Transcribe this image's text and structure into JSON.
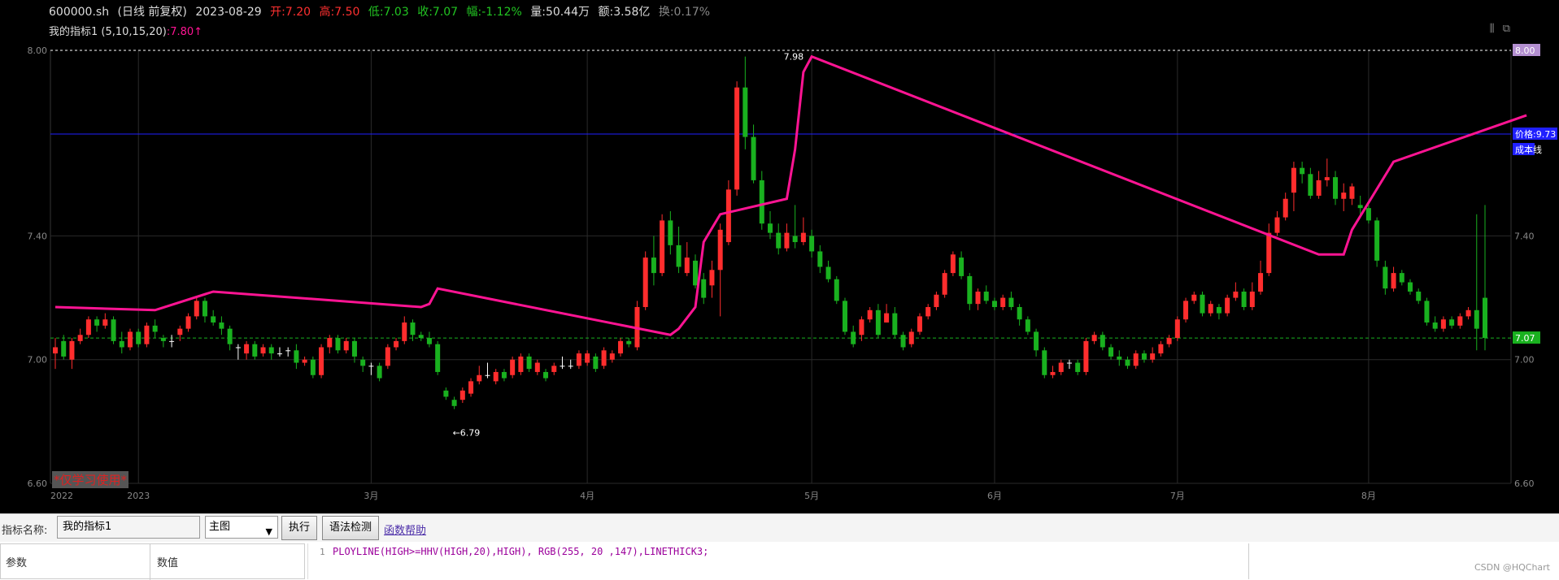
{
  "header": {
    "symbol": "600000.sh",
    "period": "(日线 前复权)",
    "date": "2023-08-29",
    "open": "开:7.20",
    "high": "高:7.50",
    "low": "低:7.03",
    "close": "收:7.07",
    "change": "幅:-1.12%",
    "volume": "量:50.44万",
    "amount": "额:3.58亿",
    "turnover": "换:0.17%"
  },
  "indicator": {
    "name": "我的指标1 (5,10,15,20)",
    "value": ":7.80",
    "arrow": "↑"
  },
  "toolbar_icons": [
    "chart-toggle-icon",
    "popout-icon"
  ],
  "watermark": "*仅学习使用*",
  "chart_data": {
    "type": "candlestick",
    "y_ticks": [
      "8.00",
      "7.40",
      "7.00",
      "6.60"
    ],
    "ylim": [
      6.6,
      8.0
    ],
    "x_ticks": [
      "2022",
      "2023",
      "3月",
      "4月",
      "5月",
      "6月",
      "7月",
      "8月"
    ],
    "high_label": "7.98",
    "low_label": "←6.79",
    "price_label": "价格:9.73",
    "cost_label": "成本线",
    "last_price": "7.07",
    "top_price": "8.00",
    "colors": {
      "up": "#ff2d2d",
      "down": "#19b11f",
      "line": "#ff1493",
      "cost_line": "#2020ff",
      "last_line": "#19b11f"
    },
    "candles": [
      [
        7.02,
        7.04,
        7.07,
        6.97
      ],
      [
        7.06,
        7.01,
        7.08,
        7.0
      ],
      [
        7.0,
        7.06,
        7.07,
        6.97
      ],
      [
        7.06,
        7.08,
        7.1,
        7.05
      ],
      [
        7.08,
        7.13,
        7.14,
        7.07
      ],
      [
        7.13,
        7.11,
        7.14,
        7.09
      ],
      [
        7.11,
        7.13,
        7.15,
        7.1
      ],
      [
        7.13,
        7.06,
        7.14,
        7.05
      ],
      [
        7.06,
        7.04,
        7.09,
        7.02
      ],
      [
        7.04,
        7.09,
        7.1,
        7.03
      ],
      [
        7.09,
        7.05,
        7.1,
        7.04
      ],
      [
        7.05,
        7.11,
        7.12,
        7.04
      ],
      [
        7.11,
        7.09,
        7.13,
        7.07
      ],
      [
        7.07,
        7.06,
        7.08,
        7.04
      ],
      [
        7.06,
        7.06,
        7.08,
        7.04
      ],
      [
        7.08,
        7.1,
        7.11,
        7.06
      ],
      [
        7.1,
        7.14,
        7.15,
        7.09
      ],
      [
        7.14,
        7.19,
        7.2,
        7.13
      ],
      [
        7.19,
        7.14,
        7.2,
        7.12
      ],
      [
        7.14,
        7.12,
        7.16,
        7.11
      ],
      [
        7.12,
        7.1,
        7.14,
        7.08
      ],
      [
        7.1,
        7.05,
        7.11,
        7.03
      ],
      [
        7.04,
        7.04,
        7.05,
        7.0
      ],
      [
        7.02,
        7.05,
        7.06,
        7.0
      ],
      [
        7.05,
        7.01,
        7.06,
        7.0
      ],
      [
        7.02,
        7.04,
        7.05,
        7.01
      ],
      [
        7.04,
        7.02,
        7.05,
        7.0
      ],
      [
        7.02,
        7.02,
        7.04,
        7.01
      ],
      [
        7.03,
        7.03,
        7.04,
        7.01
      ],
      [
        7.03,
        6.99,
        7.05,
        6.97
      ],
      [
        6.99,
        7.0,
        7.01,
        6.98
      ],
      [
        7.0,
        6.95,
        7.01,
        6.94
      ],
      [
        6.95,
        7.04,
        7.05,
        6.94
      ],
      [
        7.04,
        7.07,
        7.08,
        7.02
      ],
      [
        7.07,
        7.03,
        7.08,
        7.02
      ],
      [
        7.03,
        7.06,
        7.07,
        7.02
      ],
      [
        7.06,
        7.01,
        7.07,
        6.99
      ],
      [
        7.0,
        6.98,
        7.01,
        6.96
      ],
      [
        6.98,
        6.98,
        6.99,
        6.95
      ],
      [
        6.98,
        6.94,
        6.99,
        6.93
      ],
      [
        6.98,
        7.04,
        7.05,
        6.97
      ],
      [
        7.04,
        7.06,
        7.07,
        7.03
      ],
      [
        7.06,
        7.12,
        7.14,
        7.05
      ],
      [
        7.12,
        7.08,
        7.13,
        7.06
      ],
      [
        7.08,
        7.07,
        7.09,
        7.06
      ],
      [
        7.07,
        7.05,
        7.09,
        7.04
      ],
      [
        7.05,
        6.96,
        7.06,
        6.95
      ],
      [
        6.9,
        6.88,
        6.91,
        6.87
      ],
      [
        6.87,
        6.85,
        6.88,
        6.84
      ],
      [
        6.87,
        6.9,
        6.91,
        6.86
      ],
      [
        6.89,
        6.93,
        6.94,
        6.88
      ],
      [
        6.93,
        6.95,
        6.98,
        6.92
      ],
      [
        6.95,
        6.95,
        6.99,
        6.94
      ],
      [
        6.93,
        6.96,
        6.97,
        6.92
      ],
      [
        6.96,
        6.94,
        6.97,
        6.93
      ],
      [
        6.95,
        7.0,
        7.01,
        6.94
      ],
      [
        6.96,
        7.01,
        7.02,
        6.95
      ],
      [
        7.01,
        6.97,
        7.02,
        6.96
      ],
      [
        6.96,
        6.99,
        7.0,
        6.95
      ],
      [
        6.96,
        6.94,
        6.97,
        6.93
      ],
      [
        6.96,
        6.98,
        6.99,
        6.95
      ],
      [
        6.98,
        6.98,
        7.01,
        6.97
      ],
      [
        6.98,
        6.98,
        7.0,
        6.97
      ],
      [
        6.98,
        7.02,
        7.03,
        6.97
      ],
      [
        6.99,
        7.02,
        7.03,
        6.98
      ],
      [
        7.01,
        6.97,
        7.02,
        6.96
      ],
      [
        6.98,
        7.03,
        7.04,
        6.97
      ],
      [
        7.0,
        7.02,
        7.03,
        6.99
      ],
      [
        7.02,
        7.06,
        7.07,
        7.01
      ],
      [
        7.06,
        7.05,
        7.07,
        7.04
      ],
      [
        7.04,
        7.17,
        7.19,
        7.03
      ],
      [
        7.17,
        7.33,
        7.35,
        7.16
      ],
      [
        7.33,
        7.28,
        7.4,
        7.24
      ],
      [
        7.28,
        7.45,
        7.47,
        7.27
      ],
      [
        7.45,
        7.37,
        7.48,
        7.34
      ],
      [
        7.37,
        7.3,
        7.43,
        7.28
      ],
      [
        7.28,
        7.33,
        7.38,
        7.27
      ],
      [
        7.32,
        7.24,
        7.34,
        7.23
      ],
      [
        7.26,
        7.2,
        7.28,
        7.18
      ],
      [
        7.24,
        7.29,
        7.32,
        7.2
      ],
      [
        7.29,
        7.42,
        7.44,
        7.14
      ],
      [
        7.38,
        7.55,
        7.58,
        7.37
      ],
      [
        7.55,
        7.88,
        7.9,
        7.53
      ],
      [
        7.88,
        7.72,
        7.98,
        7.68
      ],
      [
        7.72,
        7.58,
        7.76,
        7.57
      ],
      [
        7.58,
        7.44,
        7.61,
        7.42
      ],
      [
        7.44,
        7.41,
        7.48,
        7.39
      ],
      [
        7.41,
        7.36,
        7.44,
        7.34
      ],
      [
        7.36,
        7.41,
        7.44,
        7.35
      ],
      [
        7.4,
        7.38,
        7.5,
        7.36
      ],
      [
        7.38,
        7.41,
        7.46,
        7.37
      ],
      [
        7.4,
        7.35,
        7.42,
        7.33
      ],
      [
        7.35,
        7.3,
        7.37,
        7.28
      ],
      [
        7.3,
        7.26,
        7.32,
        7.25
      ],
      [
        7.26,
        7.19,
        7.27,
        7.18
      ],
      [
        7.19,
        7.09,
        7.2,
        7.08
      ],
      [
        7.09,
        7.05,
        7.11,
        7.04
      ],
      [
        7.08,
        7.13,
        7.14,
        7.06
      ],
      [
        7.13,
        7.16,
        7.17,
        7.12
      ],
      [
        7.16,
        7.08,
        7.18,
        7.07
      ],
      [
        7.12,
        7.15,
        7.18,
        7.12
      ],
      [
        7.15,
        7.08,
        7.17,
        7.07
      ],
      [
        7.08,
        7.04,
        7.09,
        7.03
      ],
      [
        7.05,
        7.09,
        7.1,
        7.04
      ],
      [
        7.09,
        7.14,
        7.15,
        7.08
      ],
      [
        7.14,
        7.17,
        7.18,
        7.13
      ],
      [
        7.17,
        7.21,
        7.22,
        7.16
      ],
      [
        7.21,
        7.28,
        7.29,
        7.2
      ],
      [
        7.28,
        7.34,
        7.35,
        7.27
      ],
      [
        7.33,
        7.27,
        7.35,
        7.26
      ],
      [
        7.27,
        7.18,
        7.28,
        7.16
      ],
      [
        7.18,
        7.22,
        7.23,
        7.16
      ],
      [
        7.22,
        7.19,
        7.24,
        7.18
      ],
      [
        7.19,
        7.17,
        7.2,
        7.16
      ],
      [
        7.17,
        7.2,
        7.21,
        7.16
      ],
      [
        7.2,
        7.17,
        7.22,
        7.16
      ],
      [
        7.17,
        7.13,
        7.18,
        7.11
      ],
      [
        7.13,
        7.09,
        7.14,
        7.08
      ],
      [
        7.09,
        7.03,
        7.1,
        7.01
      ],
      [
        7.03,
        6.95,
        7.04,
        6.94
      ],
      [
        6.95,
        6.96,
        6.98,
        6.94
      ],
      [
        6.96,
        6.99,
        7.0,
        6.95
      ],
      [
        6.99,
        6.99,
        7.0,
        6.97
      ],
      [
        6.99,
        6.96,
        7.0,
        6.95
      ],
      [
        6.96,
        7.06,
        7.07,
        6.95
      ],
      [
        7.06,
        7.08,
        7.09,
        7.05
      ],
      [
        7.08,
        7.04,
        7.09,
        7.03
      ],
      [
        7.04,
        7.01,
        7.05,
        7.0
      ],
      [
        7.01,
        7.0,
        7.03,
        6.98
      ],
      [
        7.0,
        6.98,
        7.01,
        6.97
      ],
      [
        6.98,
        7.02,
        7.03,
        6.97
      ],
      [
        7.02,
        7.0,
        7.03,
        6.99
      ],
      [
        7.0,
        7.02,
        7.04,
        6.99
      ],
      [
        7.02,
        7.05,
        7.06,
        7.01
      ],
      [
        7.05,
        7.07,
        7.08,
        7.04
      ],
      [
        7.07,
        7.13,
        7.14,
        7.06
      ],
      [
        7.13,
        7.19,
        7.2,
        7.12
      ],
      [
        7.19,
        7.21,
        7.22,
        7.18
      ],
      [
        7.21,
        7.15,
        7.22,
        7.14
      ],
      [
        7.15,
        7.18,
        7.19,
        7.14
      ],
      [
        7.17,
        7.15,
        7.18,
        7.13
      ],
      [
        7.15,
        7.2,
        7.21,
        7.14
      ],
      [
        7.2,
        7.22,
        7.25,
        7.19
      ],
      [
        7.22,
        7.17,
        7.23,
        7.16
      ],
      [
        7.17,
        7.22,
        7.25,
        7.16
      ],
      [
        7.22,
        7.28,
        7.32,
        7.21
      ],
      [
        7.28,
        7.41,
        7.44,
        7.27
      ],
      [
        7.41,
        7.46,
        7.48,
        7.4
      ],
      [
        7.46,
        7.52,
        7.54,
        7.45
      ],
      [
        7.54,
        7.62,
        7.64,
        7.48
      ],
      [
        7.62,
        7.6,
        7.64,
        7.57
      ],
      [
        7.6,
        7.53,
        7.62,
        7.52
      ],
      [
        7.53,
        7.58,
        7.61,
        7.52
      ],
      [
        7.58,
        7.59,
        7.65,
        7.56
      ],
      [
        7.59,
        7.52,
        7.61,
        7.5
      ],
      [
        7.52,
        7.54,
        7.57,
        7.48
      ],
      [
        7.52,
        7.56,
        7.57,
        7.5
      ],
      [
        7.5,
        7.49,
        7.53,
        7.47
      ],
      [
        7.49,
        7.45,
        7.5,
        7.44
      ],
      [
        7.45,
        7.32,
        7.46,
        7.3
      ],
      [
        7.3,
        7.23,
        7.32,
        7.21
      ],
      [
        7.23,
        7.28,
        7.3,
        7.22
      ],
      [
        7.28,
        7.25,
        7.29,
        7.24
      ],
      [
        7.25,
        7.22,
        7.26,
        7.21
      ],
      [
        7.22,
        7.19,
        7.23,
        7.18
      ],
      [
        7.19,
        7.12,
        7.2,
        7.11
      ],
      [
        7.12,
        7.1,
        7.14,
        7.09
      ],
      [
        7.1,
        7.13,
        7.14,
        7.09
      ],
      [
        7.13,
        7.11,
        7.14,
        7.1
      ],
      [
        7.11,
        7.14,
        7.15,
        7.1
      ],
      [
        7.14,
        7.16,
        7.17,
        7.13
      ],
      [
        7.16,
        7.1,
        7.47,
        7.03
      ],
      [
        7.2,
        7.07,
        7.5,
        7.03
      ]
    ],
    "line_points": [
      [
        0,
        7.17
      ],
      [
        12,
        7.16
      ],
      [
        19,
        7.22
      ],
      [
        44,
        7.17
      ],
      [
        45,
        7.18
      ],
      [
        46,
        7.23
      ],
      [
        74,
        7.08
      ],
      [
        75,
        7.1
      ],
      [
        77,
        7.17
      ],
      [
        78,
        7.38
      ],
      [
        80,
        7.47
      ],
      [
        88,
        7.52
      ],
      [
        89,
        7.68
      ],
      [
        90,
        7.93
      ],
      [
        91,
        7.98
      ],
      [
        152,
        7.34
      ],
      [
        155,
        7.34
      ],
      [
        156,
        7.42
      ],
      [
        161,
        7.64
      ],
      [
        177,
        7.79
      ]
    ]
  },
  "panel": {
    "name_label": "指标名称:",
    "name_value": "我的指标1",
    "select_value": "主图",
    "execute_button": "执行",
    "syntax_button": "语法检测",
    "help_link": "函数帮助",
    "param_header": "参数",
    "value_header": "数值",
    "line_number": "1",
    "code": "PLOYLINE(HIGH>=HHV(HIGH,20),HIGH), RGB(255, 20 ,147),LINETHICK3;",
    "credit": "CSDN @HQChart"
  }
}
